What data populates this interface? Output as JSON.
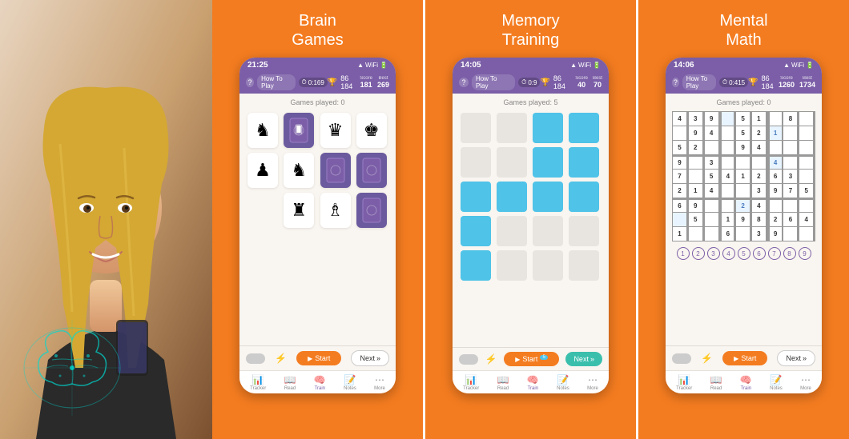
{
  "panels": [
    {
      "id": "brain-games",
      "title": "Brain\nGames",
      "time": "21:25",
      "trophy_score": "86 184",
      "how_to_play": "How To Play",
      "timer": "0:169",
      "score_label": "Score",
      "best_label": "Best",
      "score_value": "181",
      "best_value": "269",
      "games_played": "Games played: 0",
      "start_label": "Start",
      "next_label": "Next"
    },
    {
      "id": "memory-training",
      "title": "Memory\nTraining",
      "time": "14:05",
      "trophy_score": "86 184",
      "how_to_play": "How To Play",
      "timer": "0:9",
      "score_label": "Score",
      "best_label": "Best",
      "score_value": "40",
      "best_value": "70",
      "games_played": "Games played: 5",
      "start_label": "Start",
      "next_label": "Next",
      "start_badge": "5"
    },
    {
      "id": "mental-math",
      "title": "Mental\nMath",
      "time": "14:06",
      "trophy_score": "86 184",
      "how_to_play": "How To Play",
      "timer": "0:415",
      "score_label": "Score",
      "best_label": "Best",
      "score_value": "1260",
      "best_value": "1734",
      "games_played": "Games played: 0",
      "start_label": "Start",
      "next_label": "Next"
    }
  ],
  "sudoku_data": [
    [
      "4",
      "3",
      "9",
      "",
      "5",
      "1",
      "",
      "8",
      ""
    ],
    [
      "",
      "9",
      "4",
      "",
      "5",
      "2",
      "1",
      "",
      ""
    ],
    [
      "5",
      "2",
      "",
      "",
      "9",
      "4",
      "",
      "",
      ""
    ],
    [
      "9",
      "",
      "3",
      "",
      "",
      "",
      "4",
      "",
      ""
    ],
    [
      "7",
      "",
      "5",
      "4",
      "1",
      "2",
      "6",
      "3",
      ""
    ],
    [
      "2",
      "1",
      "4",
      "",
      "",
      "3",
      "9",
      "7",
      "5"
    ],
    [
      "6",
      "9",
      "",
      "",
      "2",
      "4",
      "",
      "",
      ""
    ],
    [
      "",
      "5",
      "",
      "1",
      "9",
      "8",
      "2",
      "6",
      "4"
    ],
    [
      "1",
      "",
      "",
      "6",
      "",
      "3",
      "9",
      "",
      ""
    ]
  ],
  "number_row": [
    "1",
    "2",
    "3",
    "4",
    "5",
    "6",
    "7",
    "8",
    "9"
  ],
  "nav_items": [
    "Tracker",
    "Read",
    "Train",
    "Notes",
    "More"
  ],
  "nav_icons": [
    "📊",
    "📖",
    "🧠",
    "📝",
    "⋯"
  ]
}
